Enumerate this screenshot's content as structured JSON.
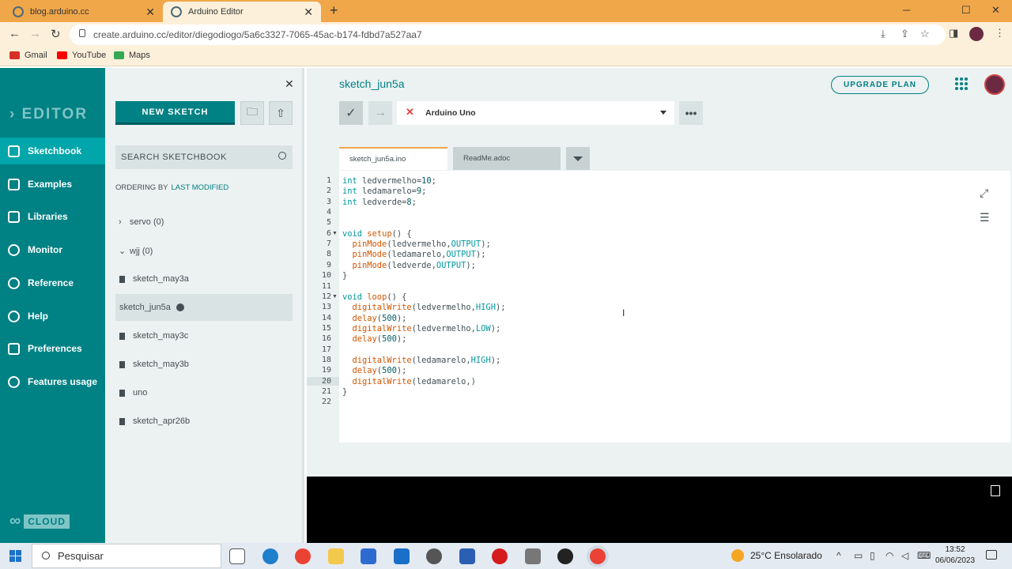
{
  "browser": {
    "tabs": [
      {
        "title": "blog.arduino.cc"
      },
      {
        "title": "Arduino Editor"
      }
    ],
    "url": "create.arduino.cc/editor/diegodiogo/5a6c3327-7065-45ac-b174-fdbd7a527aa7",
    "bookmarks": [
      "Gmail",
      "YouTube",
      "Maps"
    ]
  },
  "leftnav": {
    "logo": "EDITOR",
    "items": [
      {
        "label": "Sketchbook",
        "active": true
      },
      {
        "label": "Examples"
      },
      {
        "label": "Libraries"
      },
      {
        "label": "Monitor"
      },
      {
        "label": "Reference"
      },
      {
        "label": "Help"
      },
      {
        "label": "Preferences"
      },
      {
        "label": "Features usage"
      }
    ],
    "cloud_label": "CLOUD"
  },
  "sketchbook": {
    "new_sketch_label": "NEW SKETCH",
    "search_placeholder": "SEARCH SKETCHBOOK",
    "ordering_label": "ORDERING BY",
    "ordering_value": "LAST MODIFIED",
    "folders": [
      {
        "label": "servo (0)",
        "expanded": false
      },
      {
        "label": "wjj (0)",
        "expanded": true
      }
    ],
    "sketches": [
      "sketch_may3a",
      "sketch_jun5a",
      "sketch_may3c",
      "sketch_may3b",
      "uno",
      "sketch_apr26b"
    ],
    "active_sketch": "sketch_jun5a"
  },
  "editor": {
    "sketch_name": "sketch_jun5a",
    "upgrade_label": "UPGRADE PLAN",
    "board": "Arduino Uno",
    "tabs": [
      "sketch_jun5a.ino",
      "ReadMe.adoc"
    ],
    "current_line": 20,
    "lines": [
      "int ledvermelho=10;",
      "int ledamarelo=9;",
      "int ledverde=8;",
      "",
      "",
      "void setup() {",
      "  pinMode(ledvermelho,OUTPUT);",
      "  pinMode(ledamarelo,OUTPUT);",
      "  pinMode(ledverde,OUTPUT);",
      "}",
      "",
      "void loop() {",
      "  digitalWrite(ledvermelho,HIGH);",
      "  delay(500);",
      "  digitalWrite(ledvermelho,LOW);",
      "  delay(500);",
      "",
      "  digitalWrite(ledamarelo,HIGH);",
      "  delay(500);",
      "  digitalWrite(ledamarelo,)",
      "}",
      ""
    ]
  },
  "taskbar": {
    "search_placeholder": "Pesquisar",
    "weather": "25°C  Ensolarado",
    "time": "13:52",
    "date": "06/06/2023"
  },
  "colors": {
    "accent": "#008184",
    "chrome": "#f0a74a"
  }
}
